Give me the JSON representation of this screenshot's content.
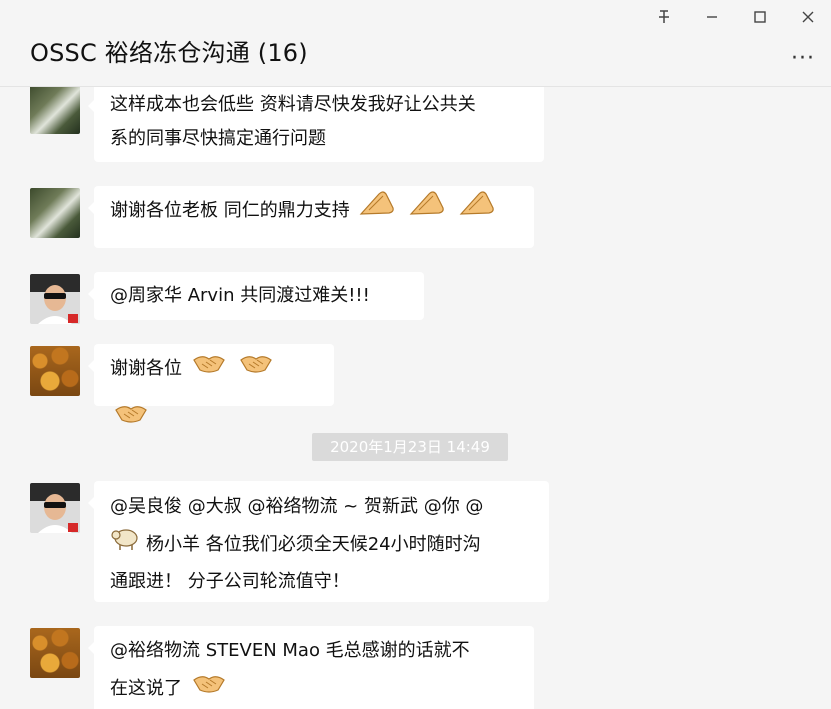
{
  "window": {
    "title": "OSSC 裕络冻仓沟通 (16)",
    "controls": {
      "pin": "ꟷ",
      "minimize": "—",
      "maximize": "☐",
      "close": "✕"
    },
    "more_label": "···"
  },
  "messages": [
    {
      "avatar": "tree-avatar",
      "lines": [
        "这样成本也会低些 资料请尽快发我好让公共关",
        "系的同事尽快搞定通行问题"
      ]
    },
    {
      "avatar": "tree-avatar",
      "text": "谢谢各位老板  同仁的鼎力支持",
      "emoji": "clap-hands-icon",
      "emoji_count": 3
    },
    {
      "avatar": "man-sunglasses-avatar",
      "text": "@周家华   Arvin 共同渡过难关!!!"
    },
    {
      "avatar": "leaves-avatar",
      "text": "谢谢各位",
      "emoji": "handshake-icon",
      "emoji_count": 3
    },
    {
      "avatar": "man-sunglasses-avatar",
      "lines": [
        "@吴良俊 @大叔 @裕络物流 ~ 贺新武 @你 @",
        "杨小羊 各位我们必须全天候24小时随时沟",
        "通跟进！ 分子公司轮流值守！"
      ],
      "inline_emoji": "sheep-icon"
    },
    {
      "avatar": "leaves-avatar",
      "lines": [
        "@裕络物流 STEVEN Mao 毛总感谢的话就不",
        "在这说了"
      ],
      "emoji": "handshake-icon"
    }
  ],
  "timestamp": "2020年1月23日 14:49"
}
